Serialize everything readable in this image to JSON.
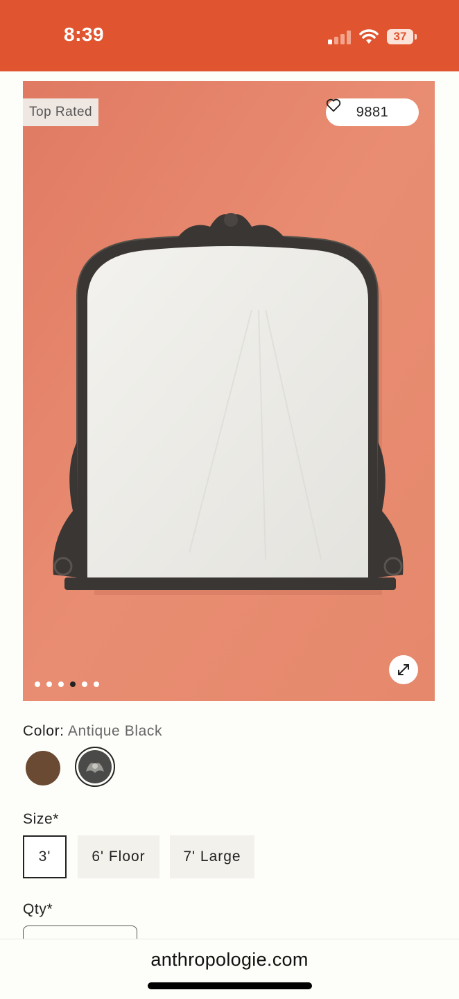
{
  "status_bar": {
    "time": "8:39",
    "battery": "37",
    "background": "#e0552f"
  },
  "product_image": {
    "badge": "Top Rated",
    "favorites_count": "9881",
    "favorite_icon": "heart-icon",
    "expand_icon": "expand-arrows-icon",
    "carousel_dots": 6,
    "carousel_active_index": 3,
    "wall_color": "#e8866b"
  },
  "color": {
    "label": "Color:",
    "selected_value": "Antique Black",
    "swatches": [
      {
        "name": "brown",
        "color": "#6a4a32"
      },
      {
        "name": "antique-black",
        "color": "#4a4a48"
      }
    ]
  },
  "size": {
    "label": "Size*",
    "options": [
      "3'",
      "6' Floor",
      "7' Large"
    ],
    "selected": "3'"
  },
  "qty": {
    "label": "Qty*"
  },
  "browser": {
    "url": "anthropologie.com"
  }
}
